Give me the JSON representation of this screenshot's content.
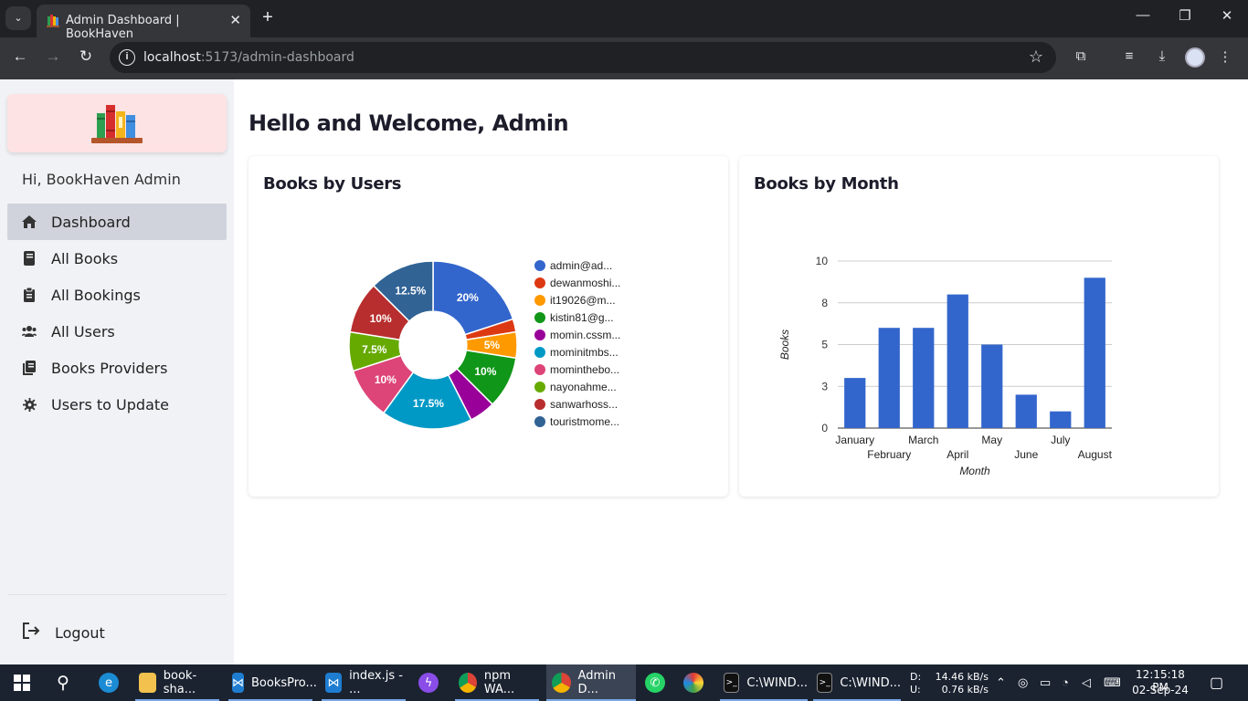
{
  "browser": {
    "tab_title": "Admin Dashboard | BookHaven",
    "url_host": "localhost",
    "url_path": ":5173/admin-dashboard"
  },
  "sidebar": {
    "greeting": "Hi, BookHaven Admin",
    "items": [
      {
        "label": "Dashboard",
        "icon": "home-icon",
        "active": true
      },
      {
        "label": "All Books",
        "icon": "book-icon"
      },
      {
        "label": "All Bookings",
        "icon": "clipboard-icon"
      },
      {
        "label": "All Users",
        "icon": "users-icon"
      },
      {
        "label": "Books Providers",
        "icon": "book-stack-icon"
      },
      {
        "label": "Users to Update",
        "icon": "gear-icon"
      }
    ],
    "logout_label": "Logout"
  },
  "main": {
    "title": "Hello and Welcome, Admin",
    "cards": {
      "users_title": "Books by Users",
      "month_title": "Books by Month"
    }
  },
  "chart_data": [
    {
      "type": "pie",
      "title": "Books by Users",
      "labels": [
        "admin@ad...",
        "dewanmoshi...",
        "it19026@m...",
        "kistin81@g...",
        "momin.cssm...",
        "mominitmbs...",
        "mominthebo...",
        "nayonahme...",
        "sanwarhoss...",
        "touristmome..."
      ],
      "values": [
        20,
        2.5,
        5,
        10,
        5,
        17.5,
        10,
        7.5,
        10,
        12.5
      ],
      "slice_labels": [
        "20%",
        "",
        "5%",
        "10%",
        "",
        "17.5%",
        "10%",
        "7.5%",
        "10%",
        "12.5%"
      ],
      "colors": [
        "#3366cc",
        "#dc3912",
        "#ff9900",
        "#109618",
        "#990099",
        "#0099c6",
        "#dd4477",
        "#66aa00",
        "#b82e2e",
        "#316395"
      ],
      "hole": 0.4,
      "legend_position": "right"
    },
    {
      "type": "bar",
      "title": "Books by Month",
      "categories": [
        "January",
        "February",
        "March",
        "April",
        "May",
        "June",
        "July",
        "August"
      ],
      "values": [
        3,
        6,
        6,
        8,
        5,
        2,
        1,
        9
      ],
      "xlabel": "Month",
      "ylabel": "Books",
      "yticks": [
        "0",
        "3",
        "5",
        "8",
        "10"
      ],
      "ytick_values": [
        0,
        2.5,
        5,
        7.5,
        10
      ],
      "ylim": [
        0,
        10
      ],
      "color": "#3366cc"
    }
  ],
  "taskbar": {
    "apps": [
      {
        "label": "book-sha..."
      },
      {
        "label": "BooksPro..."
      },
      {
        "label": "index.js - ..."
      },
      {
        "label": "npm WA..."
      },
      {
        "label": "Admin D..."
      },
      {
        "label": "C:\\WIND..."
      },
      {
        "label": "C:\\WIND..."
      }
    ],
    "net_drive_d": "D:",
    "net_drive_u": "U:",
    "net_down": "14.46 kB/s",
    "net_up": "0.76 kB/s",
    "time": "12:15:18 PM",
    "date": "02-Sep-24"
  }
}
